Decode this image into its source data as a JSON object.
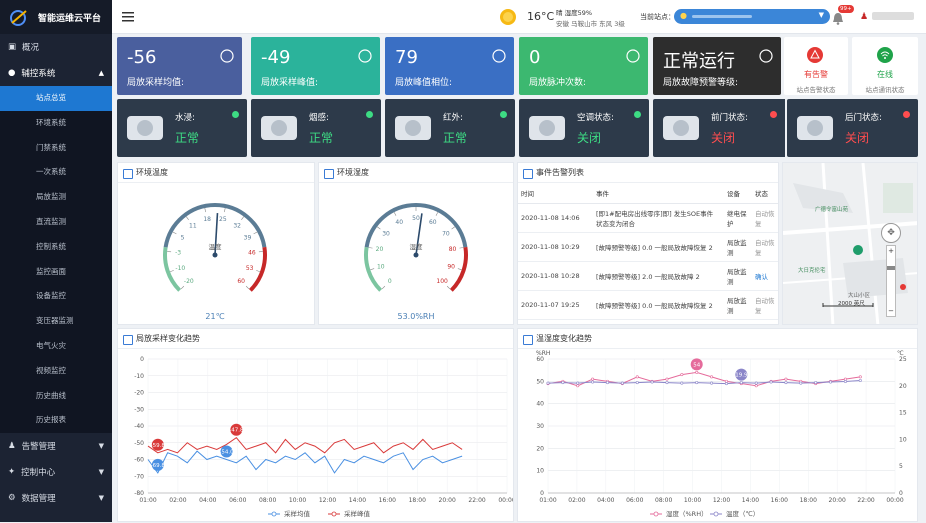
{
  "app": {
    "title": "智能运维云平台"
  },
  "sidebar": {
    "groups": [
      {
        "label": "概况"
      },
      {
        "label": "辅控系统"
      },
      {
        "label": "告警管理"
      },
      {
        "label": "控制中心"
      },
      {
        "label": "数据管理"
      }
    ],
    "sub_items": [
      "站点总览",
      "环境系统",
      "门禁系统",
      "一次系统",
      "局放监测",
      "直流监测",
      "控制系统",
      "监控画面",
      "设备监控",
      "变压器监测",
      "电气火灾",
      "视频监控",
      "历史曲线",
      "历史报表"
    ]
  },
  "topbar": {
    "weather_temp": "16°C",
    "weather_desc": "晴 湿度59%",
    "weather_loc": "安徽 马鞍山市 东风 3级",
    "site_label": "当前站点：",
    "site_value": "",
    "badge": "99+",
    "user": ""
  },
  "stats": [
    {
      "value": "-56",
      "label": "局放采样均值:",
      "color": "#4a5f9e"
    },
    {
      "value": "-49",
      "label": "局放采样峰值:",
      "color": "#2bb39b"
    },
    {
      "value": "79",
      "label": "局放峰值相位:",
      "color": "#3a6fc4"
    },
    {
      "value": "0",
      "label": "局放脉冲次数:",
      "color": "#3cb870"
    },
    {
      "value": "正常运行",
      "label": "局放故障预警等级:",
      "color": "#2d2d2d"
    }
  ],
  "status_cards": [
    {
      "state": "有告警",
      "label": "站点告警状态",
      "color": "#e53935"
    },
    {
      "state": "在线",
      "label": "站点通讯状态",
      "color": "#1fa34a"
    }
  ],
  "sensors": [
    {
      "name": "水浸:",
      "state": "正常",
      "state_color": "#3ddc84",
      "dot": "#3ddc84"
    },
    {
      "name": "烟感:",
      "state": "正常",
      "state_color": "#3ddc84",
      "dot": "#3ddc84"
    },
    {
      "name": "红外:",
      "state": "正常",
      "state_color": "#3ddc84",
      "dot": "#3ddc84"
    },
    {
      "name": "空调状态:",
      "state": "关闭",
      "state_color": "#3ddc84",
      "dot": "#3ddc84"
    },
    {
      "name": "前门状态:",
      "state": "关闭",
      "state_color": "#ff4d4f",
      "dot": "#ff4d4f"
    },
    {
      "name": "后门状态:",
      "state": "关闭",
      "state_color": "#ff4d4f",
      "dot": "#ff4d4f"
    }
  ],
  "gauges": [
    {
      "title": "环境温度",
      "unit_label": "温度",
      "value": 21,
      "display": "21℃",
      "min": -20,
      "max": 60,
      "ticks": [
        "-20",
        "-10",
        "-3",
        "5",
        "11",
        "18",
        "25",
        "32",
        "39",
        "46",
        "53",
        "60"
      ]
    },
    {
      "title": "环境湿度",
      "unit_label": "湿度",
      "value": 53,
      "display": "53.0%RH",
      "min": 0,
      "max": 100,
      "ticks": [
        "0",
        "10",
        "20",
        "30",
        "40",
        "50",
        "60",
        "70",
        "80",
        "90",
        "100"
      ]
    }
  ],
  "events": {
    "title": "事件告警列表",
    "columns": [
      "时间",
      "事件",
      "设备",
      "状态"
    ],
    "rows": [
      {
        "time": "2020-11-08 14:06",
        "event": "[即1#配电房出线零序]即] 发生SOE事件 状态变为闭合",
        "device": "继电保护",
        "status": "自动恢复"
      },
      {
        "time": "2020-11-08 10:29",
        "event": "[故障预警等级] 0.0 一般局放故障恢复 2",
        "device": "局放监测",
        "status": "自动恢复"
      },
      {
        "time": "2020-11-08 10:28",
        "event": "[故障预警等级] 2.0 一般局放故障 2",
        "device": "局放监测",
        "status": "确认"
      },
      {
        "time": "2020-11-07 19:25",
        "event": "[故障预警等级] 0.0 一般局放故障恢复 2",
        "device": "局放监测",
        "status": "自动恢复"
      }
    ]
  },
  "map": {
    "place1": "广德令富山苑",
    "place2": "大日克伦宅",
    "place3": "大山小区",
    "scale": "2000 英尺"
  },
  "chart_left": {
    "title": "局放采样变化趋势"
  },
  "chart_right": {
    "title": "温湿度变化趋势"
  },
  "chart_data": [
    {
      "type": "line",
      "title": "局放采样变化趋势",
      "categories": [
        "01:00",
        "02:00",
        "04:00",
        "06:00",
        "08:00",
        "10:00",
        "12:00",
        "14:00",
        "16:00",
        "18:00",
        "20:00",
        "22:00",
        "00:00"
      ],
      "ylim": [
        -80,
        0
      ],
      "yticks": [
        0,
        -10,
        -20,
        -30,
        -40,
        -50,
        -60,
        -70,
        -80
      ],
      "series": [
        {
          "name": "采样均值",
          "color": "#4a90e2",
          "values": [
            -60,
            -68,
            -56,
            -58,
            -62,
            -55,
            -60,
            -58,
            -60,
            -62,
            -58,
            -66,
            -60,
            -62,
            -58,
            -60,
            -56,
            -62,
            -58,
            -68,
            -60,
            -62,
            -58,
            -60,
            -62,
            -58,
            -56,
            -66,
            -60,
            -58,
            -62,
            -60,
            -58
          ]
        },
        {
          "name": "采样峰值",
          "color": "#d93a3a",
          "values": [
            -52,
            -56,
            -54,
            -56,
            -50,
            -54,
            -52,
            -54,
            -51,
            -47,
            -54,
            -52,
            -50,
            -56,
            -48,
            -54,
            -50,
            -52,
            -56,
            -50,
            -48,
            -54,
            -52,
            -50,
            -56,
            -52,
            -50,
            -54,
            -48,
            -54,
            -52,
            -50,
            -54
          ]
        }
      ],
      "annotations": [
        {
          "label": "-59.8",
          "series": "采样峰值"
        },
        {
          "label": "-47.8",
          "series": "采样峰值"
        },
        {
          "label": "-69.8",
          "series": "采样均值"
        },
        {
          "label": "-54.0",
          "series": "采样均值"
        }
      ]
    },
    {
      "type": "line",
      "title": "温湿度变化趋势",
      "ylabel_left": "%RH",
      "ylabel_right": "℃",
      "categories": [
        "01:00",
        "02:00",
        "04:00",
        "06:00",
        "08:00",
        "10:00",
        "12:00",
        "14:00",
        "16:00",
        "18:00",
        "20:00",
        "22:00",
        "00:00"
      ],
      "ylim_left": [
        0,
        60
      ],
      "ylim_right": [
        0,
        25
      ],
      "yticks_left": [
        0,
        10,
        20,
        30,
        40,
        50,
        60
      ],
      "yticks_right": [
        0,
        5,
        10,
        15,
        20,
        25
      ],
      "series": [
        {
          "name": "湿度（%RH）",
          "color": "#e56b9b",
          "values": [
            49,
            50,
            48,
            51,
            50,
            49,
            52,
            50,
            51,
            53,
            54,
            52,
            50,
            49,
            48,
            50,
            51,
            50,
            49,
            50,
            51,
            52
          ],
          "axis": "left"
        },
        {
          "name": "温度（℃）",
          "color": "#8b86c9",
          "values": [
            20.5,
            20.6,
            20.5,
            20.7,
            20.6,
            20.5,
            20.6,
            20.7,
            20.6,
            20.5,
            20.6,
            20.5,
            20.4,
            20.6,
            20.5,
            20.7,
            20.6,
            20.5,
            20.6,
            20.7,
            20.8,
            21
          ],
          "axis": "right"
        }
      ],
      "annotations": [
        {
          "label": "54",
          "series": "湿度（%RH）"
        },
        {
          "label": "19.9",
          "series": "温度（℃）"
        }
      ]
    }
  ]
}
